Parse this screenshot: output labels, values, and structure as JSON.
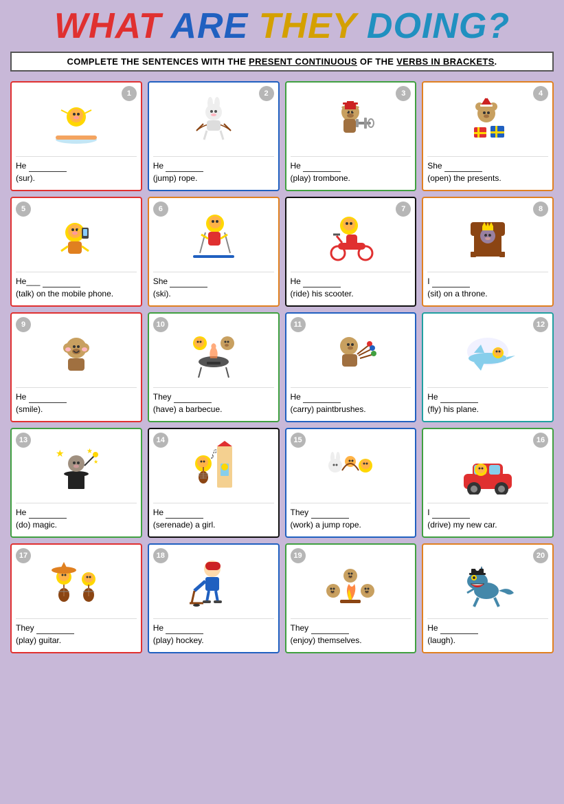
{
  "title": {
    "part1": "What ",
    "part2": "Are ",
    "part3": "They ",
    "part4": "Doing?"
  },
  "instruction": {
    "text": "Complete the sentences with the",
    "underline1": "present continuous",
    "middle": "of the",
    "underline2": "verbs in brackets",
    "end": "."
  },
  "cards": [
    {
      "num": 1,
      "numPos": "right",
      "border": "red",
      "sentence": "He ___ ___ ___",
      "verb": "(sur)."
    },
    {
      "num": 2,
      "numPos": "right",
      "border": "blue",
      "sentence": "He ___ ___ ___",
      "verb": "(jump) rope."
    },
    {
      "num": 3,
      "numPos": "right",
      "border": "green",
      "sentence": "He ___ ___ ___",
      "verb": "(play) trombone."
    },
    {
      "num": 4,
      "numPos": "right",
      "border": "orange",
      "sentence": "She ___ ___",
      "verb": "(open) the presents."
    },
    {
      "num": 5,
      "numPos": "left",
      "border": "red",
      "sentence": "He___ ___ ___",
      "verb": "(talk) on the mobile phone."
    },
    {
      "num": 6,
      "numPos": "left",
      "border": "orange",
      "sentence": "She ___ ___",
      "verb": "(ski)."
    },
    {
      "num": 7,
      "numPos": "right",
      "border": "black",
      "sentence": "He ___ ___ ___",
      "verb": "(ride) his scooter."
    },
    {
      "num": 8,
      "numPos": "right",
      "border": "orange",
      "sentence": "I ___ ___ ___",
      "verb": "(sit) on a throne."
    },
    {
      "num": 9,
      "numPos": "left",
      "border": "red",
      "sentence": "He ___ ___ ___",
      "verb": "(smile)."
    },
    {
      "num": 10,
      "numPos": "left",
      "border": "green",
      "sentence": "They ___ ___",
      "verb": "(have) a barbecue."
    },
    {
      "num": 11,
      "numPos": "left",
      "border": "blue",
      "sentence": "He ___ ___ ___",
      "verb": "(carry) paintbrushes."
    },
    {
      "num": 12,
      "numPos": "right",
      "border": "teal",
      "sentence": "He ___ ___ ___",
      "verb": "(fly) his plane."
    },
    {
      "num": 13,
      "numPos": "left",
      "border": "green",
      "sentence": "He ___ ___ ___",
      "verb": "(do) magic."
    },
    {
      "num": 14,
      "numPos": "left",
      "border": "black",
      "sentence": "He ___ ___",
      "verb": "(serenade) a girl."
    },
    {
      "num": 15,
      "numPos": "left",
      "border": "blue",
      "sentence": "They ___ ___",
      "verb": "(work) a jump rope."
    },
    {
      "num": 16,
      "numPos": "right",
      "border": "green",
      "sentence": "I ___ ___ ___",
      "verb": "(drive) my new car."
    },
    {
      "num": 17,
      "numPos": "left",
      "border": "red",
      "sentence": "They ___ ___",
      "verb": "(play) guitar."
    },
    {
      "num": 18,
      "numPos": "left",
      "border": "blue",
      "sentence": "He ___ ___ ___",
      "verb": "(play) hockey."
    },
    {
      "num": 19,
      "numPos": "left",
      "border": "green",
      "sentence": "They ___ ___",
      "verb": "(enjoy) themselves."
    },
    {
      "num": 20,
      "numPos": "right",
      "border": "orange",
      "sentence": "He ___ ___",
      "verb": "(laugh)."
    }
  ],
  "emojis": [
    "🏄",
    "🐇",
    "🐒",
    "🐻",
    "🦁",
    "🦁",
    "🦁",
    "🐱",
    "🐒",
    "🦁",
    "🐒",
    "🦁",
    "🐱",
    "🦁",
    "🐇",
    "🦁",
    "🦁",
    "🏒",
    "🐒",
    "🦎"
  ]
}
